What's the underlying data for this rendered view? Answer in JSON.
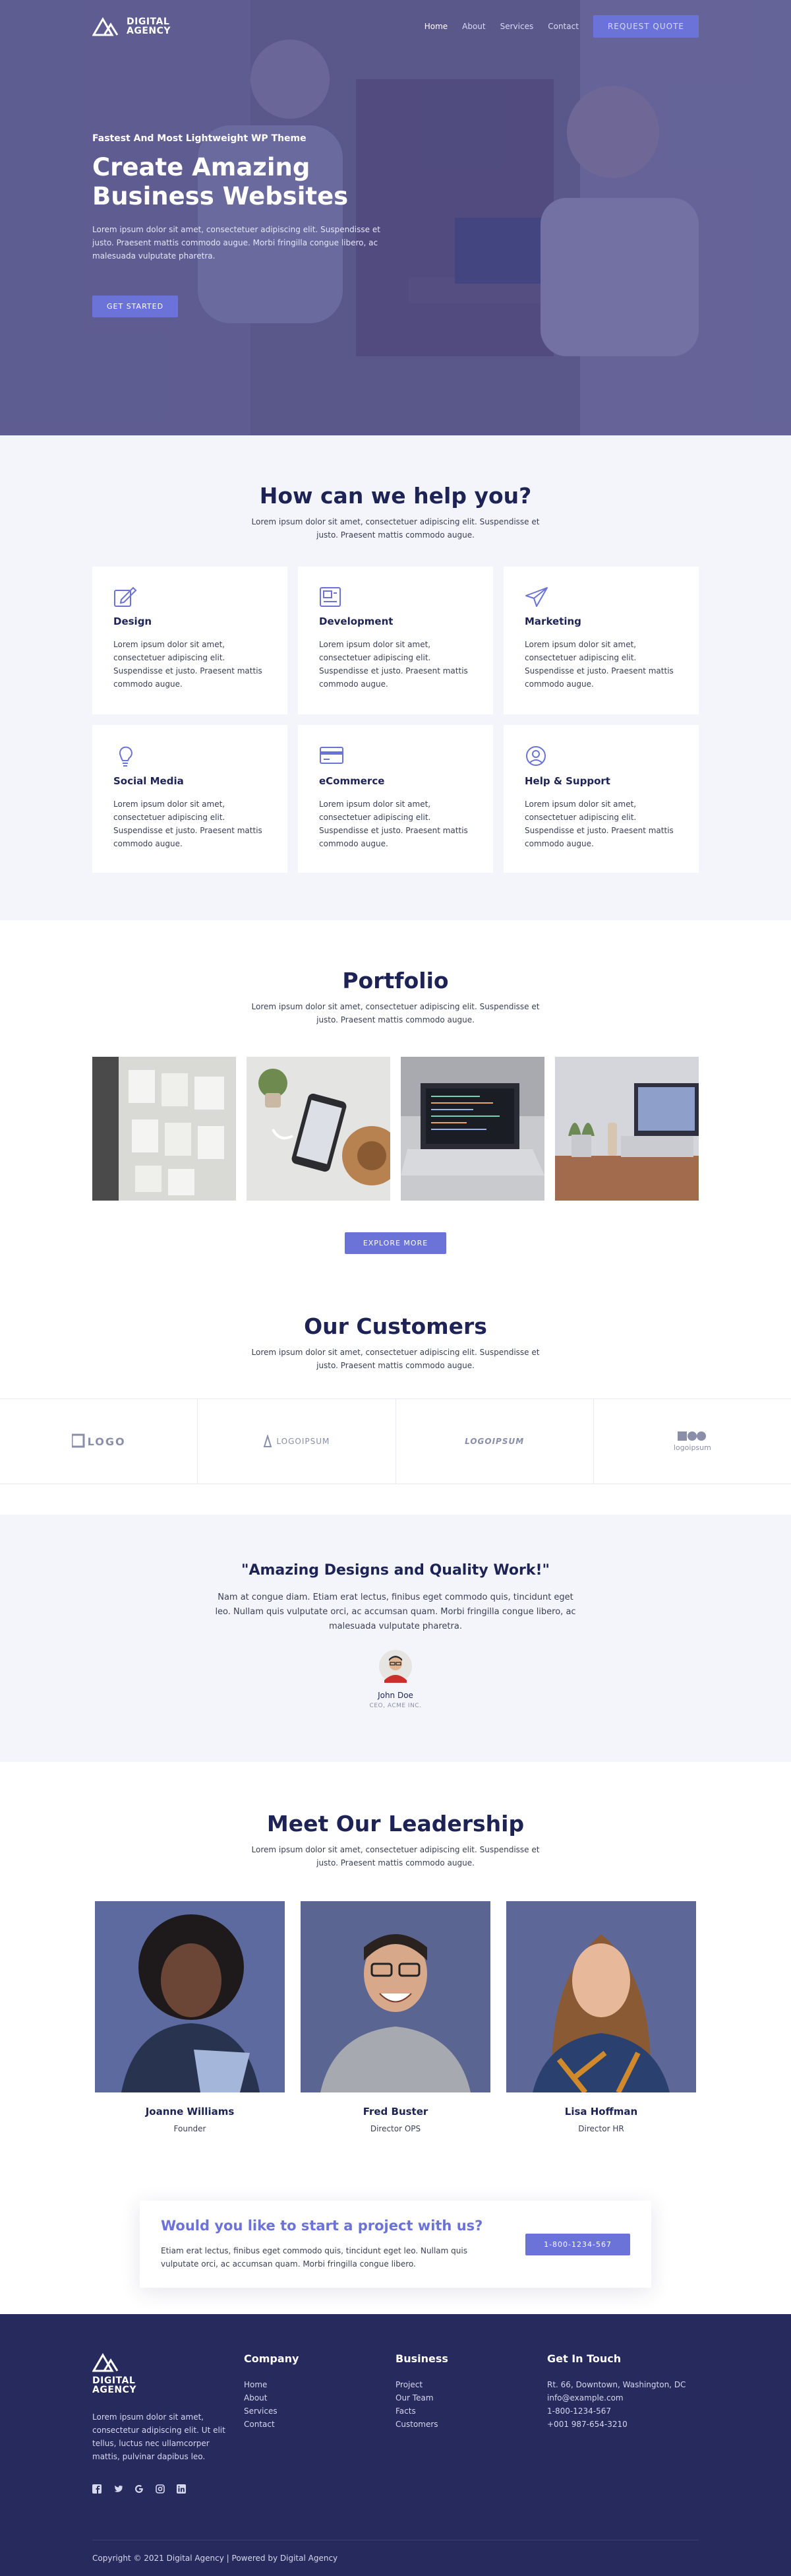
{
  "brand": {
    "line1": "DIGITAL",
    "line2": "AGENCY"
  },
  "nav": {
    "items": [
      "Home",
      "About",
      "Services",
      "Contact"
    ],
    "cta": "REQUEST QUOTE"
  },
  "hero": {
    "eyebrow": "Fastest And Most Lightweight WP Theme",
    "title": "Create Amazing Business Websites",
    "text": "Lorem ipsum dolor sit amet, consectetuer adipiscing elit. Suspendisse et justo. Praesent mattis commodo augue. Morbi fringilla congue libero, ac malesuada vulputate pharetra.",
    "button": "GET STARTED"
  },
  "help": {
    "title": "How can we help you?",
    "subtitle": "Lorem ipsum dolor sit amet, consectetuer adipiscing elit. Suspendisse et justo. Praesent mattis commodo augue.",
    "services": [
      {
        "icon": "edit-icon",
        "title": "Design",
        "text": "Lorem ipsum dolor sit amet, consectetuer adipiscing elit. Suspendisse et justo. Praesent mattis commodo augue."
      },
      {
        "icon": "layout-icon",
        "title": "Development",
        "text": "Lorem ipsum dolor sit amet, consectetuer adipiscing elit. Suspendisse et justo. Praesent mattis commodo augue."
      },
      {
        "icon": "paper-plane-icon",
        "title": "Marketing",
        "text": "Lorem ipsum dolor sit amet, consectetuer adipiscing elit. Suspendisse et justo. Praesent mattis commodo augue."
      },
      {
        "icon": "lightbulb-icon",
        "title": "Social Media",
        "text": "Lorem ipsum dolor sit amet, consectetuer adipiscing elit. Suspendisse et justo. Praesent mattis commodo augue."
      },
      {
        "icon": "credit-card-icon",
        "title": "eCommerce",
        "text": "Lorem ipsum dolor sit amet, consectetuer adipiscing elit. Suspendisse et justo. Praesent mattis commodo augue."
      },
      {
        "icon": "user-circle-icon",
        "title": "Help & Support",
        "text": "Lorem ipsum dolor sit amet, consectetuer adipiscing elit. Suspendisse et justo. Praesent mattis commodo augue."
      }
    ]
  },
  "portfolio": {
    "title": "Portfolio",
    "subtitle": "Lorem ipsum dolor sit amet, consectetuer adipiscing elit. Suspendisse et justo. Praesent mattis commodo augue.",
    "button": "EXPLORE MORE"
  },
  "customers": {
    "title": "Our Customers",
    "subtitle": "Lorem ipsum dolor sit amet, consectetuer adipiscing elit. Suspendisse et justo. Praesent mattis commodo augue.",
    "logos": [
      "LOGO",
      "LOGOIPSUM",
      "LOGOIPSUM",
      "logoipsum"
    ]
  },
  "testimonial": {
    "title": "\"Amazing Designs and Quality Work!\"",
    "text": "Nam at congue diam. Etiam erat lectus, finibus eget commodo quis, tincidunt eget leo. Nullam quis vulputate orci, ac accumsan quam. Morbi fringilla congue libero, ac malesuada vulputate pharetra.",
    "author": "John Doe",
    "role": "CEO, ACME INC."
  },
  "leadership": {
    "title": "Meet Our Leadership",
    "subtitle": "Lorem ipsum dolor sit amet, consectetuer adipiscing elit. Suspendisse et justo. Praesent mattis commodo augue.",
    "members": [
      {
        "name": "Joanne Williams",
        "role": "Founder"
      },
      {
        "name": "Fred Buster",
        "role": "Director OPS"
      },
      {
        "name": "Lisa Hoffman",
        "role": "Director HR"
      }
    ]
  },
  "cta": {
    "title": "Would you like to start a project with us?",
    "text": "Etiam erat lectus, finibus eget commodo quis, tincidunt eget leo. Nullam quis vulputate orci, ac accumsan quam. Morbi fringilla congue libero.",
    "button": "1-800-1234-567"
  },
  "footer": {
    "about": "Lorem ipsum dolor sit amet, consectetur adipiscing elit. Ut elit tellus, luctus nec ullamcorper mattis, pulvinar dapibus leo.",
    "company_title": "Company",
    "company_links": [
      "Home",
      "About",
      "Services",
      "Contact"
    ],
    "business_title": "Business",
    "business_links": [
      "Project",
      "Our Team",
      "Facts",
      "Customers"
    ],
    "contact_title": "Get In Touch",
    "contact_items": [
      "Rt. 66, Downtown, Washington, DC",
      "info@example.com",
      "1-800-1234-567",
      "+001 987-654-3210"
    ],
    "social_icons": [
      "facebook-icon",
      "twitter-icon",
      "google-icon",
      "instagram-icon",
      "linkedin-icon"
    ],
    "copyright": "Copyright © 2021 Digital Agency | Powered by Digital Agency"
  },
  "colors": {
    "accent": "#6b73d8",
    "navy": "#1e2356",
    "footer": "#262a5c",
    "grey": "#f4f5fa"
  }
}
